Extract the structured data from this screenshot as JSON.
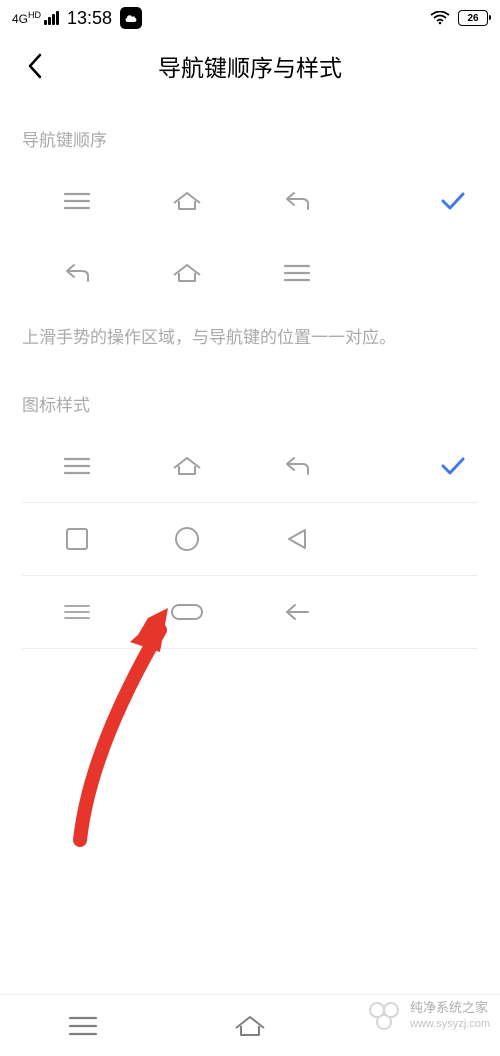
{
  "status": {
    "network": "4G",
    "network_sub": "HD",
    "time": "13:58",
    "battery_pct": "26"
  },
  "header": {
    "title": "导航键顺序与样式"
  },
  "sections": {
    "order_label": "导航键顺序",
    "style_label": "图标样式",
    "hint": "上滑手势的操作区域，与导航键的位置一一对应。"
  },
  "order_options": [
    {
      "layout": [
        "menu",
        "home",
        "back"
      ],
      "selected": true
    },
    {
      "layout": [
        "back",
        "home",
        "menu"
      ],
      "selected": false
    }
  ],
  "style_options": [
    {
      "icons": [
        "menu-lines",
        "home-outline",
        "back-outline"
      ],
      "selected": true
    },
    {
      "icons": [
        "square",
        "circle",
        "triangle"
      ],
      "selected": false
    },
    {
      "icons": [
        "menu-thin",
        "pill",
        "arrow-left"
      ],
      "selected": false
    }
  ],
  "watermark": {
    "line1": "纯净系统之家",
    "line2": "www.sysyzj.com"
  },
  "colors": {
    "icon": "#a0a0a0",
    "check": "#4678e6",
    "arrow": "#e6352b"
  }
}
